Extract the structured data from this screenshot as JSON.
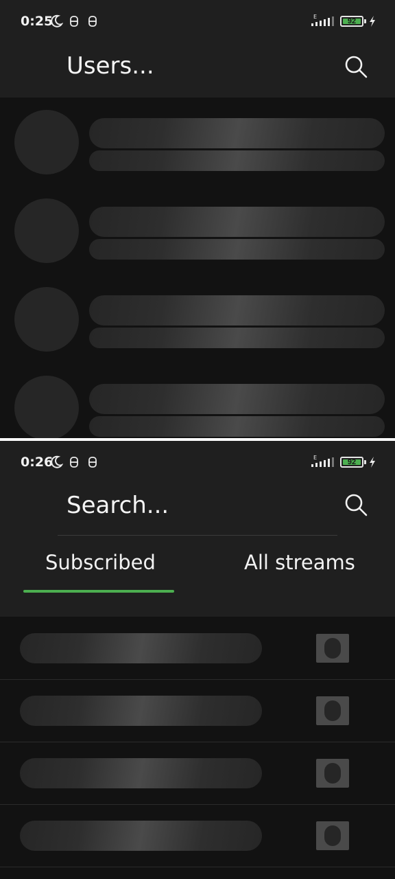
{
  "screens": [
    {
      "status": {
        "time": "0:25",
        "battery": "92"
      },
      "title": "Users..."
    },
    {
      "status": {
        "time": "0:26",
        "battery": "92"
      },
      "title": "Search...",
      "tabs": [
        {
          "label": "Subscribed",
          "active": true
        },
        {
          "label": "All streams",
          "active": false
        }
      ]
    }
  ],
  "icons": {
    "moon": "moon-icon",
    "notification": "notification-icon",
    "signal": "signal-icon",
    "battery": "battery-icon",
    "charging": "bolt-icon",
    "search": "search-icon",
    "stream_placeholder": "stream-placeholder-icon"
  },
  "colors": {
    "background": "#121212",
    "appbar": "#1f1f1f",
    "accent": "#4caf50",
    "placeholder": "#262626",
    "text": "#ffffff"
  }
}
